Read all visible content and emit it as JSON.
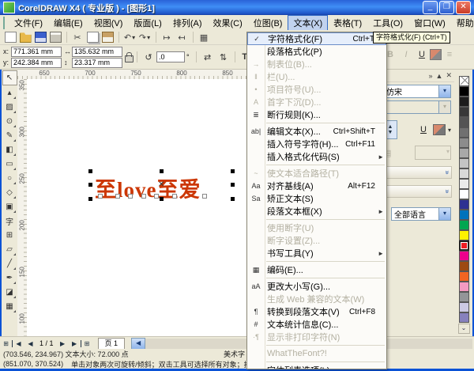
{
  "window": {
    "title": "CorelDRAW X4 ( 专业版 ) - [图形1]",
    "buttons": {
      "minimize": "_",
      "restore": "❐",
      "close": "✕"
    }
  },
  "menubar": {
    "items": [
      {
        "label": "文件(F)"
      },
      {
        "label": "编辑(E)"
      },
      {
        "label": "视图(V)"
      },
      {
        "label": "版面(L)"
      },
      {
        "label": "排列(A)"
      },
      {
        "label": "效果(C)"
      },
      {
        "label": "位图(B)"
      },
      {
        "label": "文本(X)",
        "active": true
      },
      {
        "label": "表格(T)"
      },
      {
        "label": "工具(O)"
      },
      {
        "label": "窗口(W)"
      },
      {
        "label": "帮助(H)"
      }
    ],
    "doc_controls": [
      "–",
      "❐",
      "✕"
    ]
  },
  "toolbar": {
    "icons": [
      "new",
      "open",
      "save",
      "print",
      "sep",
      "cut",
      "copy",
      "paste",
      "sep",
      "undo",
      "redo",
      "sep",
      "import",
      "export",
      "sep",
      "app-launcher"
    ]
  },
  "propbar": {
    "x_label": "x:",
    "x_value": "771.361 mm",
    "y_label": "y:",
    "y_value": "242.384 mm",
    "w_icon": "↔",
    "w_value": "135.632 mm",
    "h_icon": "↕",
    "h_value": "23.317 mm",
    "angle_value": ".0",
    "angle_unit": "°",
    "mirror_h": "⇄",
    "mirror_v": "⇅",
    "text_format": "Tt",
    "bold": "B",
    "italic": "I",
    "underline": "U",
    "align": "≡"
  },
  "toolbox": {
    "tools": [
      {
        "name": "pick-tool",
        "glyph": "↖",
        "selected": true,
        "fly": false
      },
      {
        "name": "shape-tool",
        "glyph": "▴",
        "fly": true
      },
      {
        "name": "crop-tool",
        "glyph": "▨",
        "fly": true
      },
      {
        "name": "zoom-tool",
        "glyph": "⊙",
        "fly": true
      },
      {
        "name": "freehand-tool",
        "glyph": "✎",
        "fly": true
      },
      {
        "name": "smart-fill-tool",
        "glyph": "◧",
        "fly": true
      },
      {
        "name": "rectangle-tool",
        "glyph": "▭",
        "fly": true
      },
      {
        "name": "ellipse-tool",
        "glyph": "○",
        "fly": true
      },
      {
        "name": "polygon-tool",
        "glyph": "◇",
        "fly": true
      },
      {
        "name": "basic-shapes-tool",
        "glyph": "▣",
        "fly": true
      },
      {
        "name": "text-tool",
        "glyph": "字",
        "fly": false
      },
      {
        "name": "table-tool",
        "glyph": "⊞",
        "fly": false
      },
      {
        "name": "blend-tool",
        "glyph": "▱",
        "fly": true
      },
      {
        "name": "eyedropper-tool",
        "glyph": "╱",
        "fly": true
      },
      {
        "name": "outline-tool",
        "glyph": "✒",
        "fly": true
      },
      {
        "name": "fill-tool",
        "glyph": "◪",
        "fly": true
      },
      {
        "name": "interactive-fill-tool",
        "glyph": "▦",
        "fly": true
      }
    ]
  },
  "rulers": {
    "h_ticks": [
      "650",
      "700",
      "750",
      "800",
      "850"
    ],
    "v_ticks": [
      "350",
      "300",
      "250",
      "200",
      "150",
      "100"
    ]
  },
  "canvas": {
    "text": "至love至爱",
    "text_color": "#cc3705"
  },
  "text_menu": {
    "items": [
      {
        "label": "字符格式化(F)",
        "shortcut": "Ctrl+T",
        "icon": "check",
        "state": "selected"
      },
      {
        "label": "段落格式化(P)"
      },
      {
        "label": "制表位(B)...",
        "state": "disabled",
        "icon": "tab-settings"
      },
      {
        "label": "栏(U)...",
        "state": "disabled",
        "icon": "columns"
      },
      {
        "label": "项目符号(U)...",
        "state": "disabled",
        "icon": "bullets"
      },
      {
        "label": "首字下沉(D)...",
        "state": "disabled",
        "icon": "drop-cap"
      },
      {
        "label": "断行规则(K)...",
        "icon": "line-rules"
      },
      {
        "sep": true
      },
      {
        "label": "编辑文本(X)...",
        "shortcut": "Ctrl+Shift+T",
        "icon": "edit-text"
      },
      {
        "label": "插入符号字符(H)...",
        "shortcut": "Ctrl+F11"
      },
      {
        "label": "插入格式化代码(S)",
        "arrow": true
      },
      {
        "sep": true
      },
      {
        "label": "使文本适合路径(T)",
        "state": "disabled",
        "icon": "fit-text-path"
      },
      {
        "label": "对齐基线(A)",
        "shortcut": "Alt+F12",
        "icon": "align-baseline"
      },
      {
        "label": "矫正文本(S)",
        "icon": "straighten-text"
      },
      {
        "label": "段落文本框(X)",
        "arrow": true
      },
      {
        "sep": true
      },
      {
        "label": "使用断字(U)",
        "state": "disabled"
      },
      {
        "label": "断字设置(Z)...",
        "state": "disabled"
      },
      {
        "label": "书写工具(Y)",
        "arrow": true
      },
      {
        "sep": true
      },
      {
        "label": "编码(E)...",
        "icon": "encoding"
      },
      {
        "sep": true
      },
      {
        "label": "更改大小写(G)...",
        "icon": "change-case"
      },
      {
        "label": "生成 Web 兼容的文本(W)",
        "state": "disabled"
      },
      {
        "label": "转换到段落文本(V)",
        "shortcut": "Ctrl+F8",
        "icon": "convert-paragraph"
      },
      {
        "label": "文本统计信息(C)...",
        "icon": "text-stats"
      },
      {
        "label": "显示非打印字符(N)",
        "state": "disabled",
        "icon": "nonprinting"
      },
      {
        "sep": true
      },
      {
        "label": "WhatTheFont?!",
        "state": "disabled"
      },
      {
        "sep": true
      },
      {
        "label": "字体列表选项(L)...",
        "icon": "font-list"
      }
    ]
  },
  "tooltip": {
    "text": "字符格式化(F) (Ctrl+T)"
  },
  "docker": {
    "controls": {
      "collapse": "»",
      "pin": "▲",
      "close": "✕"
    },
    "font_name": "仿宋",
    "underline": "U",
    "language": "全部语言"
  },
  "palette": {
    "colors": [
      {
        "name": "none",
        "hex": ""
      },
      {
        "name": "black",
        "hex": "#000000"
      },
      {
        "name": "90%-black",
        "hex": "#1c1c1c"
      },
      {
        "name": "80%-black",
        "hex": "#383838"
      },
      {
        "name": "70%-black",
        "hex": "#545454"
      },
      {
        "name": "60%-black",
        "hex": "#707070"
      },
      {
        "name": "50%-black",
        "hex": "#8c8c8c"
      },
      {
        "name": "40%-black",
        "hex": "#a8a8a8"
      },
      {
        "name": "30%-black",
        "hex": "#c4c4c4"
      },
      {
        "name": "20%-black",
        "hex": "#d9d9d9"
      },
      {
        "name": "10%-black",
        "hex": "#ebebeb"
      },
      {
        "name": "white",
        "hex": "#ffffff"
      },
      {
        "name": "blue-navy",
        "hex": "#2e3192"
      },
      {
        "name": "blue",
        "hex": "#0072bc"
      },
      {
        "name": "green",
        "hex": "#00a651"
      },
      {
        "name": "yellow",
        "hex": "#fff200"
      },
      {
        "name": "red",
        "hex": "#ed1c24",
        "selected": true
      },
      {
        "name": "magenta",
        "hex": "#ec008c"
      },
      {
        "name": "brown",
        "hex": "#9d4a12"
      },
      {
        "name": "orange",
        "hex": "#f26522"
      },
      {
        "name": "pink",
        "hex": "#f49ac1"
      },
      {
        "name": "gray",
        "hex": "#939598"
      },
      {
        "name": "lavender",
        "hex": "#ccc9e4"
      },
      {
        "name": "purple",
        "hex": "#8781bd"
      }
    ],
    "more": "⌄"
  },
  "pagenav": {
    "add_page": "⊞",
    "first": "◀",
    "prev": "◀",
    "counter": "1 / 1",
    "next": "▶",
    "last": "▶",
    "add_page2": "⊞",
    "page_tab": "页 1",
    "scroll_left": "◀"
  },
  "statusbar": {
    "line1_left": "(703.546, 234.967)  文本大小: 72.000 点",
    "line1_right": "美术字",
    "line2_coords": "(851.070, 370.524)",
    "line2_hint": "单击对象两次可旋转/倾斜；双击工具可选择所有对象；按住"
  }
}
